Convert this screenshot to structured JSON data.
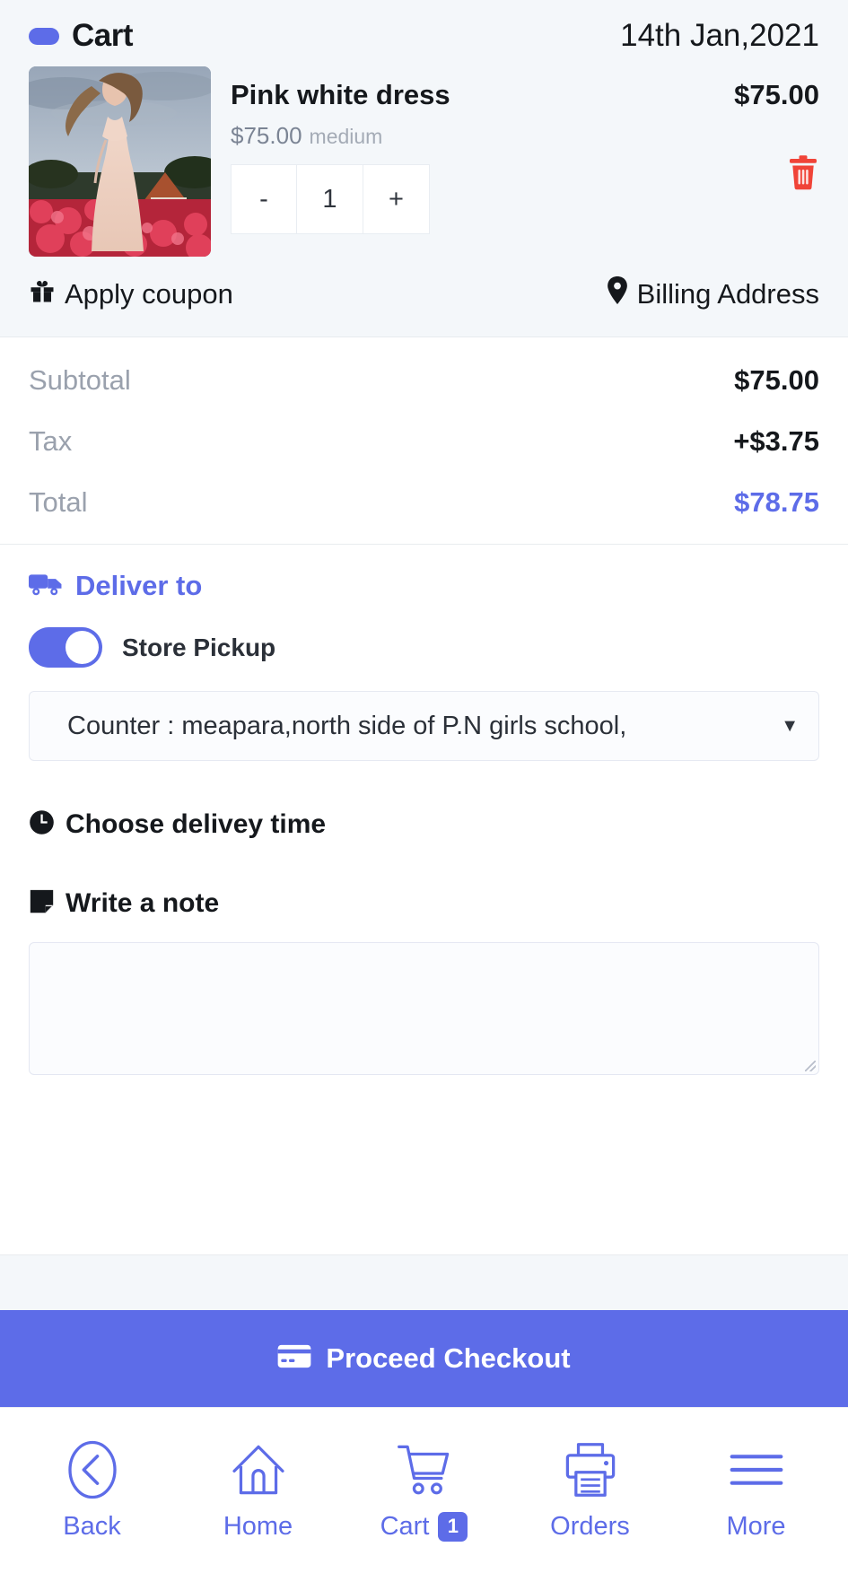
{
  "cart": {
    "title": "Cart",
    "date": "14th Jan,2021",
    "icon": "cart-pill-icon",
    "item": {
      "name": "Pink white dress",
      "unit_price": "$75.00",
      "size": "medium",
      "line_price": "$75.00",
      "quantity": "1",
      "decrement_label": "-",
      "increment_label": "+",
      "remove_icon": "trash-icon",
      "image_alt": "woman in pink dress in flower field"
    },
    "actions": {
      "coupon_label": "Apply coupon",
      "coupon_icon": "gift-icon",
      "billing_label": "Billing Address",
      "billing_icon": "location-pin-icon"
    }
  },
  "totals": [
    {
      "label": "Subtotal",
      "value": "$75.00",
      "accent": false
    },
    {
      "label": "Tax",
      "value": "+$3.75",
      "accent": false
    },
    {
      "label": "Total",
      "value": "$78.75",
      "accent": true
    }
  ],
  "delivery": {
    "heading": "Deliver to",
    "heading_icon": "truck-icon",
    "pickup_label": "Store Pickup",
    "pickup_enabled": true,
    "location_value": "Counter : meapara,north side of P.N girls school,",
    "location_caret": "▼",
    "time_heading": "Choose delivey time",
    "time_icon": "clock-icon",
    "note_heading": "Write a note",
    "note_icon": "sticky-note-icon",
    "note_value": "",
    "note_placeholder": ""
  },
  "checkout": {
    "label": "Proceed Checkout",
    "icon": "credit-card-icon"
  },
  "bottom_nav": [
    {
      "label": "Back",
      "icon": "back-circle-icon",
      "badge": ""
    },
    {
      "label": "Home",
      "icon": "home-icon",
      "badge": ""
    },
    {
      "label": "Cart",
      "icon": "shopping-cart-icon",
      "badge": "1"
    },
    {
      "label": "Orders",
      "icon": "printer-icon",
      "badge": ""
    },
    {
      "label": "More",
      "icon": "hamburger-icon",
      "badge": ""
    }
  ],
  "colors": {
    "accent": "#5d6ce8",
    "panel": "#f4f7fa",
    "danger": "#f04438",
    "text": "#15181c",
    "muted": "#9aa1ad"
  }
}
